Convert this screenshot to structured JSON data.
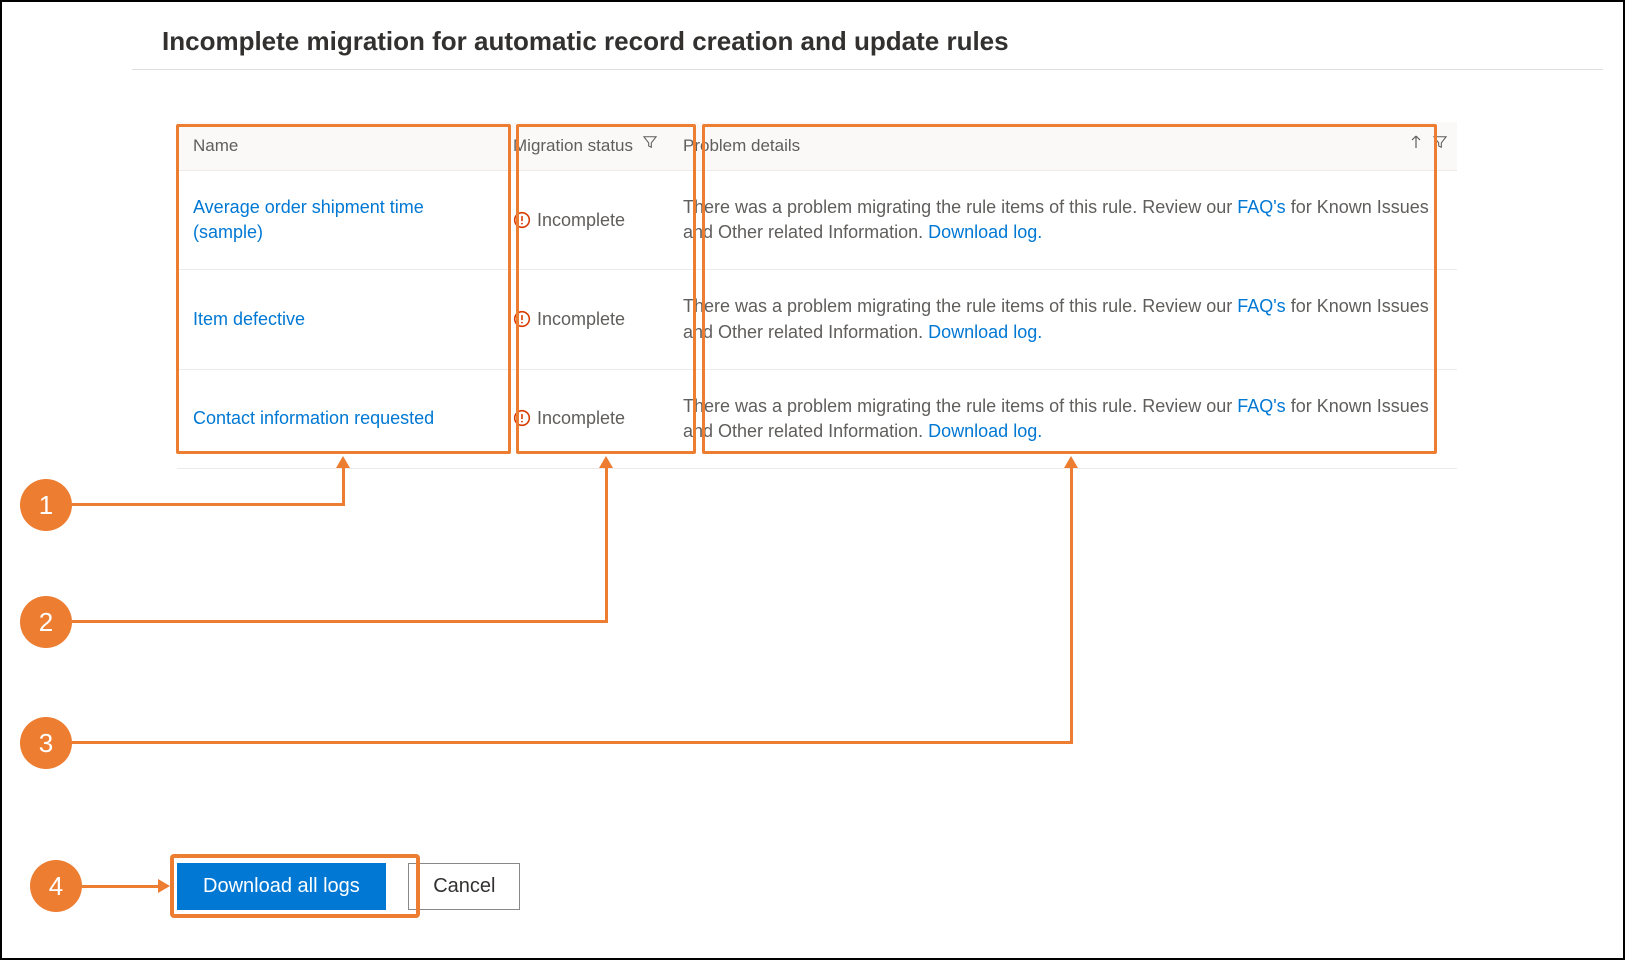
{
  "title": "Incomplete migration for automatic record creation and update rules",
  "columns": {
    "name": "Name",
    "status": "Migration status",
    "detail": "Problem details"
  },
  "status_label": "Incomplete",
  "detail_text_prefix": "There was a problem migrating the rule items of this rule. Review our ",
  "detail_faq": "FAQ's",
  "detail_text_mid": " for Known Issues and Other related Information. ",
  "detail_download": "Download log.",
  "rows": [
    {
      "name": "Average order shipment time (sample)"
    },
    {
      "name": "Item defective"
    },
    {
      "name": "Contact information requested"
    }
  ],
  "buttons": {
    "download_all": "Download all logs",
    "cancel": "Cancel"
  },
  "callouts": {
    "n1": "1",
    "n2": "2",
    "n3": "3",
    "n4": "4"
  }
}
